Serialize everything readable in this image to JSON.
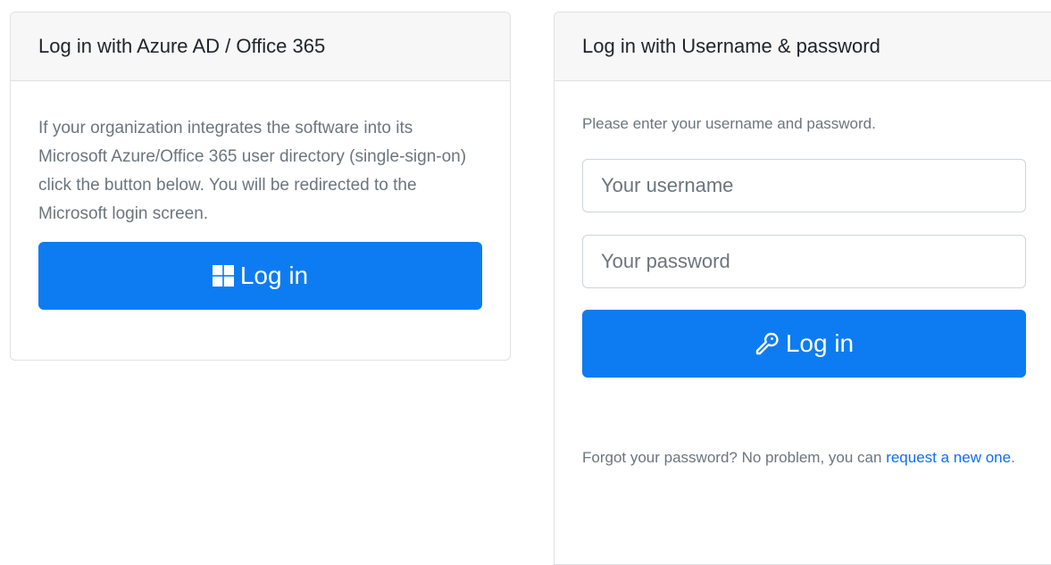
{
  "azure_card": {
    "title": "Log in with Azure AD / Office 365",
    "description": "If your organization integrates the software into its Microsoft Azure/Office 365 user directory (single-sign-on) click the button below. You will be redirected to the Microsoft login screen.",
    "button_label": "Log in",
    "button_icon": "windows-logo-icon"
  },
  "password_card": {
    "title": "Log in with Username & password",
    "instructions": "Please enter your username and password.",
    "username_placeholder": "Your username",
    "password_placeholder": "Your password",
    "username_value": "",
    "password_value": "",
    "button_label": "Log in",
    "button_icon": "key-icon",
    "forgot_text": "Forgot your password? No problem, you can",
    "forgot_link": "request a new one",
    "forgot_suffix": "."
  },
  "colors": {
    "primary": "#0d7cf2",
    "link": "#0d6efd",
    "header_bg": "#f7f7f7",
    "muted_text": "#6c757d"
  }
}
